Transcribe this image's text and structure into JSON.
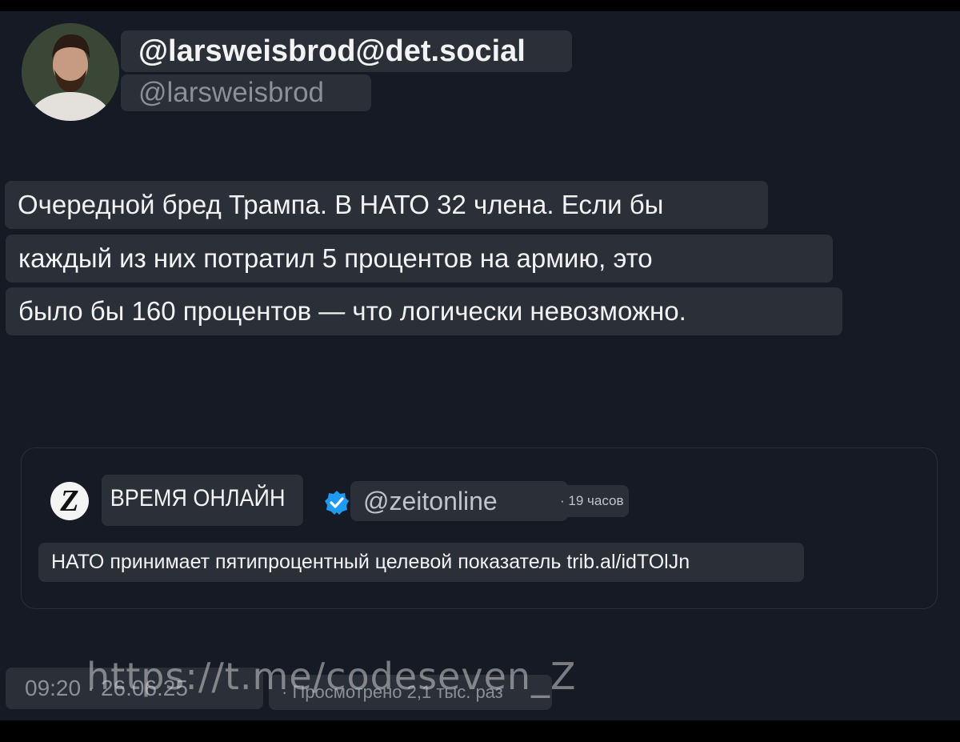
{
  "author": {
    "display_name": "@larsweisbrod@det.social",
    "handle": "@larsweisbrod",
    "avatar_icon": "person-avatar"
  },
  "post": {
    "lines": [
      "Очередной бред Трампа. В НАТО 32 члена. Если бы",
      "каждый из них потратил 5 процентов на армию, это",
      "было бы 160 процентов — что логически невозможно."
    ]
  },
  "quoted_post": {
    "logo_letter": "Z",
    "name": "ВРЕМЯ ОНЛАЙН",
    "verified_icon": "verified-badge-icon",
    "verified_color": "#1d9bf0",
    "handle": "@zeitonline",
    "time": "· 19 часов",
    "text": "НАТО принимает пятипроцентный целевой показатель trib.al/idTOlJn"
  },
  "meta": {
    "timestamp": "09:20 · 26.06.25",
    "views": "· Просмотрено 2,1 тыс. раз"
  },
  "watermark": "https://t.me/codeseven_Z"
}
